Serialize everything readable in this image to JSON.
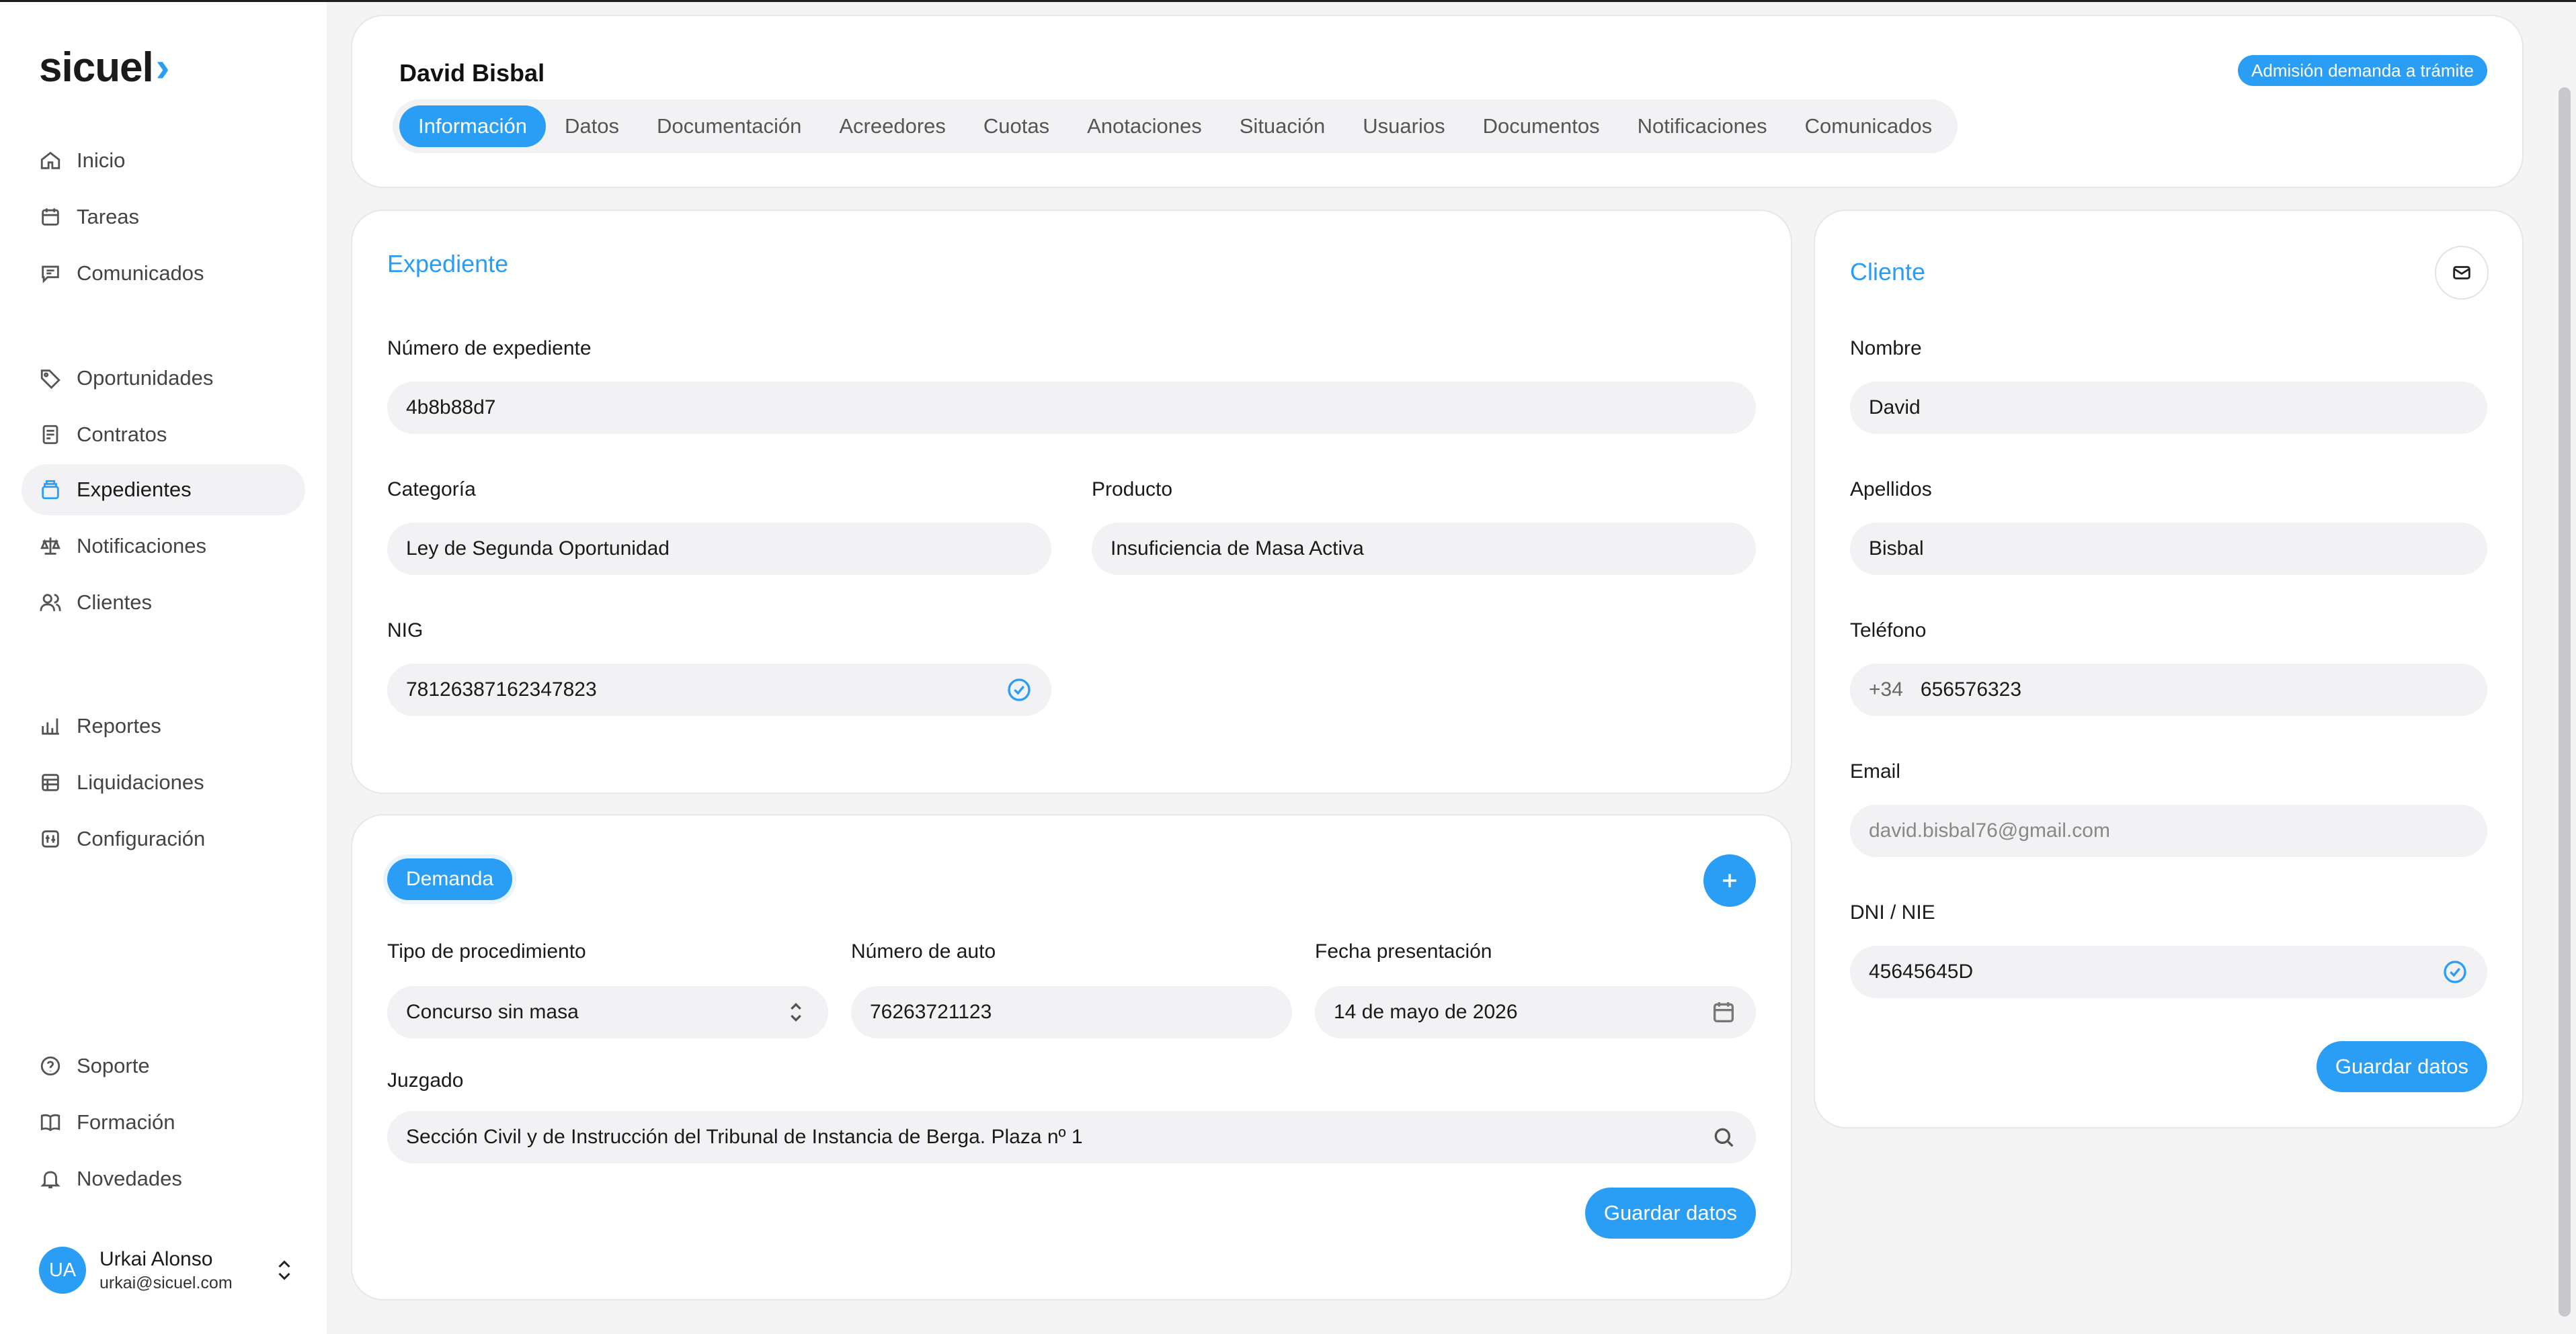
{
  "app": {
    "logo_text": "sicuel",
    "logo_mark": "›"
  },
  "sidebar": {
    "items": [
      {
        "label": "Inicio",
        "icon": "home-icon",
        "active": false
      },
      {
        "label": "Tareas",
        "icon": "calendar-icon",
        "active": false
      },
      {
        "label": "Comunicados",
        "icon": "message-icon",
        "active": false
      },
      {
        "label": "Oportunidades",
        "icon": "tag-icon",
        "active": false
      },
      {
        "label": "Contratos",
        "icon": "contract-icon",
        "active": false
      },
      {
        "label": "Expedientes",
        "icon": "folder-icon",
        "active": true
      },
      {
        "label": "Notificaciones",
        "icon": "scale-icon",
        "active": false
      },
      {
        "label": "Clientes",
        "icon": "users-icon",
        "active": false
      },
      {
        "label": "Reportes",
        "icon": "bar-chart-icon",
        "active": false
      },
      {
        "label": "Liquidaciones",
        "icon": "layers-icon",
        "active": false
      },
      {
        "label": "Configuración",
        "icon": "settings-icon",
        "active": false
      },
      {
        "label": "Soporte",
        "icon": "help-icon",
        "active": false
      },
      {
        "label": "Formación",
        "icon": "book-icon",
        "active": false
      },
      {
        "label": "Novedades",
        "icon": "bell-icon",
        "active": false
      }
    ],
    "user": {
      "initials": "UA",
      "name": "Urkai Alonso",
      "email": "urkai@sicuel.com"
    }
  },
  "header": {
    "client_name": "David Bisbal",
    "status_badge": "Admisión demanda a trámite",
    "tabs": [
      {
        "label": "Información",
        "active": true
      },
      {
        "label": "Datos",
        "active": false
      },
      {
        "label": "Documentación",
        "active": false
      },
      {
        "label": "Acreedores",
        "active": false
      },
      {
        "label": "Cuotas",
        "active": false
      },
      {
        "label": "Anotaciones",
        "active": false
      },
      {
        "label": "Situación",
        "active": false
      },
      {
        "label": "Usuarios",
        "active": false
      },
      {
        "label": "Documentos",
        "active": false
      },
      {
        "label": "Notificaciones",
        "active": false
      },
      {
        "label": "Comunicados",
        "active": false
      }
    ]
  },
  "expediente": {
    "title": "Expediente",
    "numero_label": "Número de expediente",
    "numero_value": "4b8b88d7",
    "categoria_label": "Categoría",
    "categoria_value": "Ley de Segunda Oportunidad",
    "producto_label": "Producto",
    "producto_value": "Insuficiencia de Masa Activa",
    "nig_label": "NIG",
    "nig_value": "78126387162347823"
  },
  "demanda": {
    "pill_label": "Demanda",
    "tipo_label": "Tipo de procedimiento",
    "tipo_value": "Concurso sin masa",
    "auto_label": "Número de auto",
    "auto_value": "76263721123",
    "fecha_label": "Fecha presentación",
    "fecha_value": "14 de mayo de 2026",
    "juzgado_label": "Juzgado",
    "juzgado_value": "Sección Civil y de Instrucción del Tribunal de Instancia de Berga. Plaza nº 1",
    "save_label": "Guardar datos"
  },
  "cliente": {
    "title": "Cliente",
    "nombre_label": "Nombre",
    "nombre_value": "David",
    "apellidos_label": "Apellidos",
    "apellidos_value": "Bisbal",
    "telefono_label": "Teléfono",
    "telefono_prefix": "+34",
    "telefono_value": "656576323",
    "email_label": "Email",
    "email_value": "david.bisbal76@gmail.com",
    "dni_label": "DNI / NIE",
    "dni_value": "45645645D",
    "save_label": "Guardar datos"
  },
  "colors": {
    "accent": "#2a9df4",
    "field_bg": "#f2f2f4",
    "background": "#f4f4f5"
  }
}
